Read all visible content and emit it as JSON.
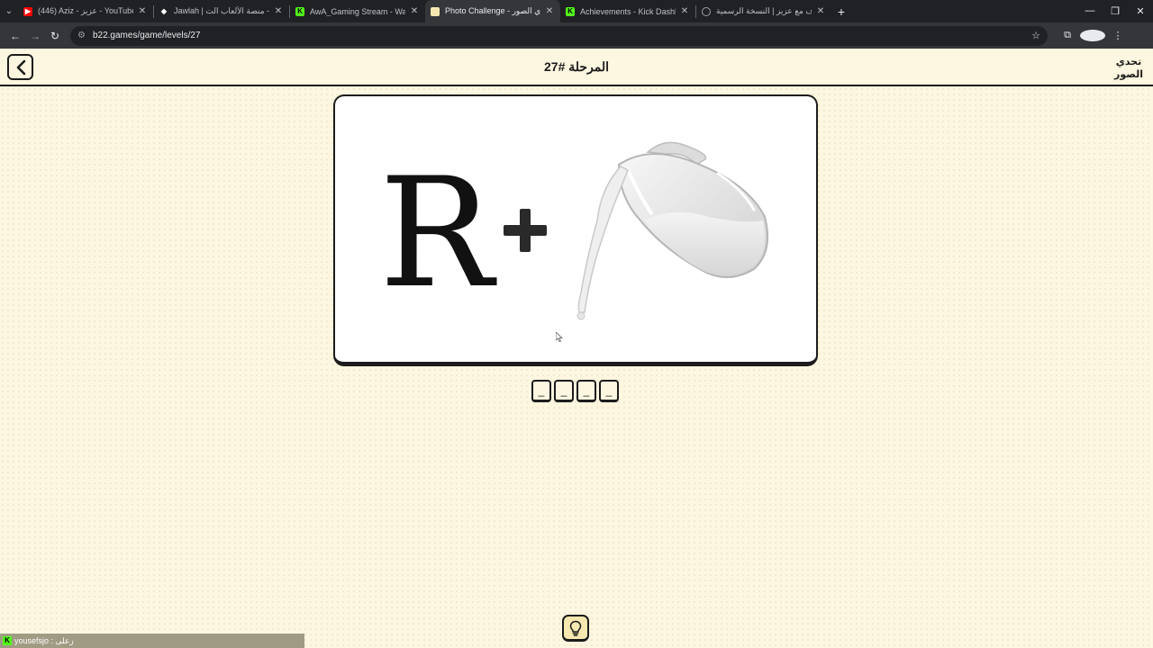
{
  "browser": {
    "tabs": [
      {
        "label": "(446) Aziz - عزيز - YouTube",
        "icon": "youtube-icon",
        "color": "#ff0000",
        "active": false
      },
      {
        "label": "Jawlah | جولة - منصة الألعاب الت...",
        "icon": "jawlah-icon",
        "color": "#ffffff",
        "active": false
      },
      {
        "label": "AwA_Gaming Stream - Watch L...",
        "icon": "kick-icon",
        "color": "#53fc18",
        "active": false
      },
      {
        "label": "Photo Challenge - تحدي الصور ...",
        "icon": "photo-challenge-icon",
        "color": "#f6e8b0",
        "active": true
      },
      {
        "label": "Achievements - Kick Dashboard",
        "icon": "kick-icon",
        "color": "#53fc18",
        "active": false
      },
      {
        "label": "حروف مع عزيز | النسخة الرسمية",
        "icon": "globe-icon",
        "color": "#9aa0a6",
        "active": false
      }
    ],
    "url": "b22.games/game/levels/27"
  },
  "header": {
    "level_title": "المرحلة #27"
  },
  "puzzle": {
    "letter": "R",
    "operator": "+",
    "image": "milk-pitcher"
  },
  "answer": {
    "slots": [
      "_",
      "_",
      "_",
      "_"
    ]
  },
  "hint": {
    "icon": "lightbulb-icon"
  },
  "status_bar": {
    "text": "yousefsjo : زعلى"
  },
  "colors": {
    "page_bg": "#fdf6e0",
    "ink": "#1c1c1c",
    "accent": "#f6e8b0"
  }
}
